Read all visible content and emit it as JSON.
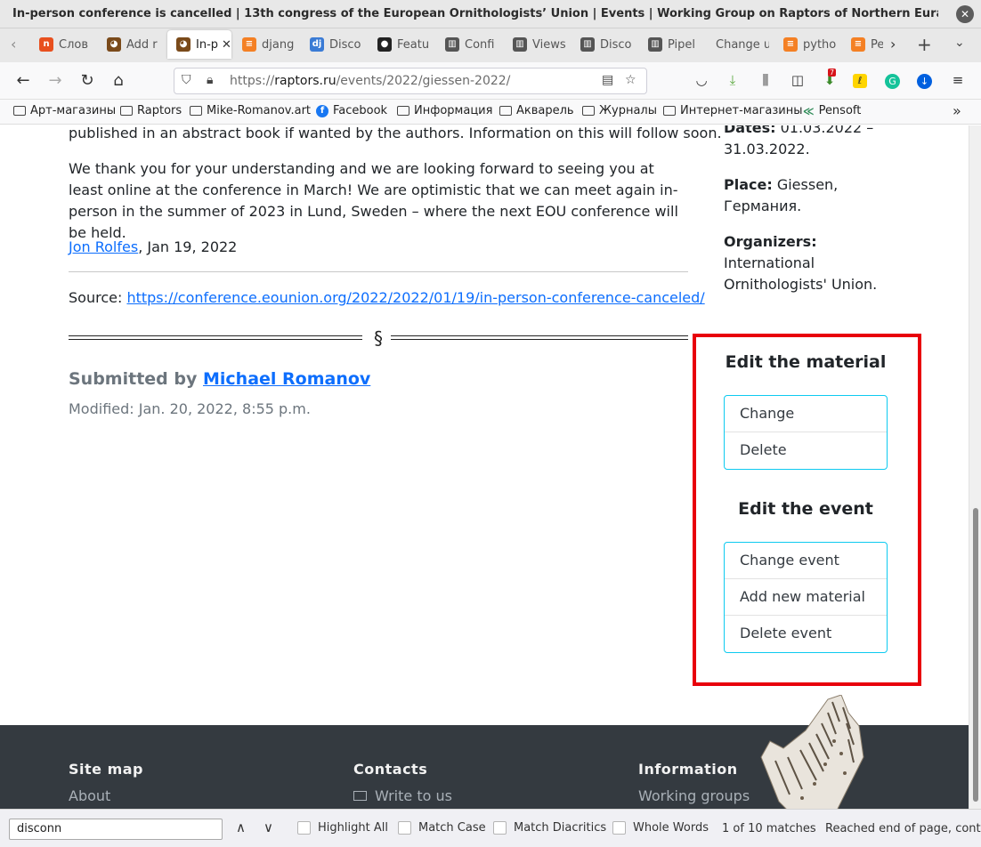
{
  "window": {
    "title": "In-person conference is cancelled | 13th congress of the European Ornithologists’ Union | Events | Working Group on Raptors of Northern Eurasia — Mozilla Firefox"
  },
  "tabs": [
    {
      "label": "Слов",
      "fav_color": "#e8501f",
      "fav_text": "n"
    },
    {
      "label": "Add r",
      "fav_color": "#7a4a1a",
      "fav_text": "◕"
    },
    {
      "label": "In-p",
      "fav_color": "#7a4a1a",
      "fav_text": "◕",
      "active": true
    },
    {
      "label": "djang",
      "fav_color": "#f48024",
      "fav_text": "≡"
    },
    {
      "label": "Disco",
      "fav_color": "#3a7bd5",
      "fav_text": "dj"
    },
    {
      "label": "Featu",
      "fav_color": "#222222",
      "fav_text": "●"
    },
    {
      "label": "Confi",
      "fav_color": "#555555",
      "fav_text": "▥"
    },
    {
      "label": "Views",
      "fav_color": "#555555",
      "fav_text": "▥"
    },
    {
      "label": "Disco",
      "fav_color": "#555555",
      "fav_text": "▥"
    },
    {
      "label": "Pipel",
      "fav_color": "#555555",
      "fav_text": "▥"
    },
    {
      "label": "Change u",
      "fav_color": "",
      "fav_text": ""
    },
    {
      "label": "pytho",
      "fav_color": "#f48024",
      "fav_text": "≡"
    },
    {
      "label": "Pe",
      "fav_color": "#f48024",
      "fav_text": "≡"
    }
  ],
  "navbar": {
    "url_prefix": "https://",
    "url_host": "raptors.ru",
    "url_path": "/events/2022/giessen-2022/",
    "badge_count": "7"
  },
  "bookmarks": [
    {
      "label": "Арт-магазины",
      "icon": "folder"
    },
    {
      "label": "Raptors",
      "icon": "folder"
    },
    {
      "label": "Mike-Romanov.art",
      "icon": "folder"
    },
    {
      "label": "Facebook",
      "icon": "facebook"
    },
    {
      "label": "Информация",
      "icon": "folder"
    },
    {
      "label": "Акварель",
      "icon": "folder"
    },
    {
      "label": "Журналы",
      "icon": "folder"
    },
    {
      "label": "Интернет-магазины",
      "icon": "folder"
    },
    {
      "label": "Pensoft",
      "icon": "pensoft"
    }
  ],
  "article": {
    "para_first": "published in an abstract book if wanted by the authors. Information on this will follow soon.",
    "para_thanks": "We thank you for your understanding and we are looking forward to seeing you at least online at the conference in March! We are optimistic that we can meet again in-person in the summer of 2023 in Lund, Sweden – where the next EOU conference will be held.",
    "author_name": "Jon Rolfes",
    "author_date": ", Jan 19, 2022",
    "source_label": "Source: ",
    "source_url": "https://conference.eounion.org/2022/2022/01/19/in-person-conference-canceled/",
    "section_sign": "§",
    "submitted_label": "Submitted by ",
    "submitted_by": "Michael Romanov",
    "modified": "Modified: Jan. 20, 2022, 8:55 p.m."
  },
  "event_info": {
    "dates_label": "Dates:",
    "dates_value_1": " 01.03.2022 –",
    "dates_value_2": "31.03.2022.",
    "place_label": "Place:",
    "place_value_1": " Giessen,",
    "place_value_2": "Германия.",
    "organizers_label": "Organizers:",
    "organizers_value_1": "International",
    "organizers_value_2": "Ornithologists' Union."
  },
  "edit_material": {
    "heading": "Edit the material",
    "items": [
      "Change",
      "Delete"
    ]
  },
  "edit_event": {
    "heading": "Edit the event",
    "items": [
      "Change event",
      "Add new material",
      "Delete event"
    ]
  },
  "footer": {
    "col1_heading": "Site map",
    "col1_link": "About",
    "col2_heading": "Contacts",
    "col2_link": "Write to us",
    "col3_heading": "Information",
    "col3_link": "Working groups"
  },
  "findbar": {
    "query": "disconn",
    "highlight_all": "Highlight All",
    "match_case": "Match Case",
    "match_diacritics": "Match Diacritics",
    "whole_words": "Whole Words",
    "matches": "1 of 10 matches",
    "status": "Reached end of page, continued from top"
  }
}
